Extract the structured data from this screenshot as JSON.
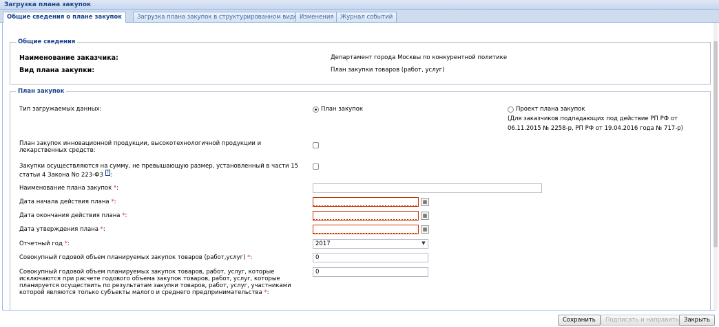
{
  "window": {
    "title": "Загрузка плана закупок"
  },
  "tabs": [
    {
      "label": "Общие сведения о плане закупок",
      "active": true
    },
    {
      "label": "Загрузка плана закупок в структурированном виде"
    },
    {
      "label": "Изменения"
    },
    {
      "label": "Журнал событий"
    }
  ],
  "general": {
    "legend": "Общие сведения",
    "customer_label": "Наименование заказчика:",
    "customer_value": "Департамент города Москвы по конкурентной политике",
    "plan_type_label": "Вид плана закупки:",
    "plan_type_value": "План закупки товаров (работ, услуг)"
  },
  "plan": {
    "legend": "План закупок",
    "data_type_label": "Тип загружаемых данных:",
    "radio_plan": "План закупок",
    "radio_project": "Проект плана закупок",
    "radio_project_note1": "(Для заказчиков подпадающих под действие РП РФ от",
    "radio_project_note2": "06.11.2015 № 2258-р, РП РФ от 19.04.2016 года № 717-р)",
    "innovation_label": "План закупок инновационной продукции, высокотехнологичной продукции и лекарственных средств:",
    "small_sum_label": "Закупки осуществляются на сумму, не превышающую размер, установленный в части 15 статьи 4 Закона No 223-ФЗ",
    "small_sum_help": "?",
    "name_label": "Наименование плана закупок",
    "name_value": "",
    "start_label": "Дата начала действия плана",
    "start_value": "",
    "end_label": "Дата окончания действия плана",
    "end_value": "",
    "approve_label": "Дата утверждения плана",
    "approve_value": "",
    "year_label": "Отчетный год",
    "year_value": "2017",
    "total_label": "Совокупный годовой объем планируемых закупок товаров (работ,услуг)",
    "total_value": "0",
    "sme_label": "Совокупный годовой объем планируемых закупок товаров, работ, услуг, которые исключаются при расчете годового объема закупок товаров, работ, услуг, которые планируется осуществить по результатам закупки товаров, работ, услуг, участниками которой являются только субъекты малого и среднего предпринимательства",
    "sme_value": "0",
    "required_mark": "*",
    "colon": ":"
  },
  "buttons": {
    "save": "Сохранить",
    "sign": "Подписать и направить",
    "close": "Закрыть"
  }
}
